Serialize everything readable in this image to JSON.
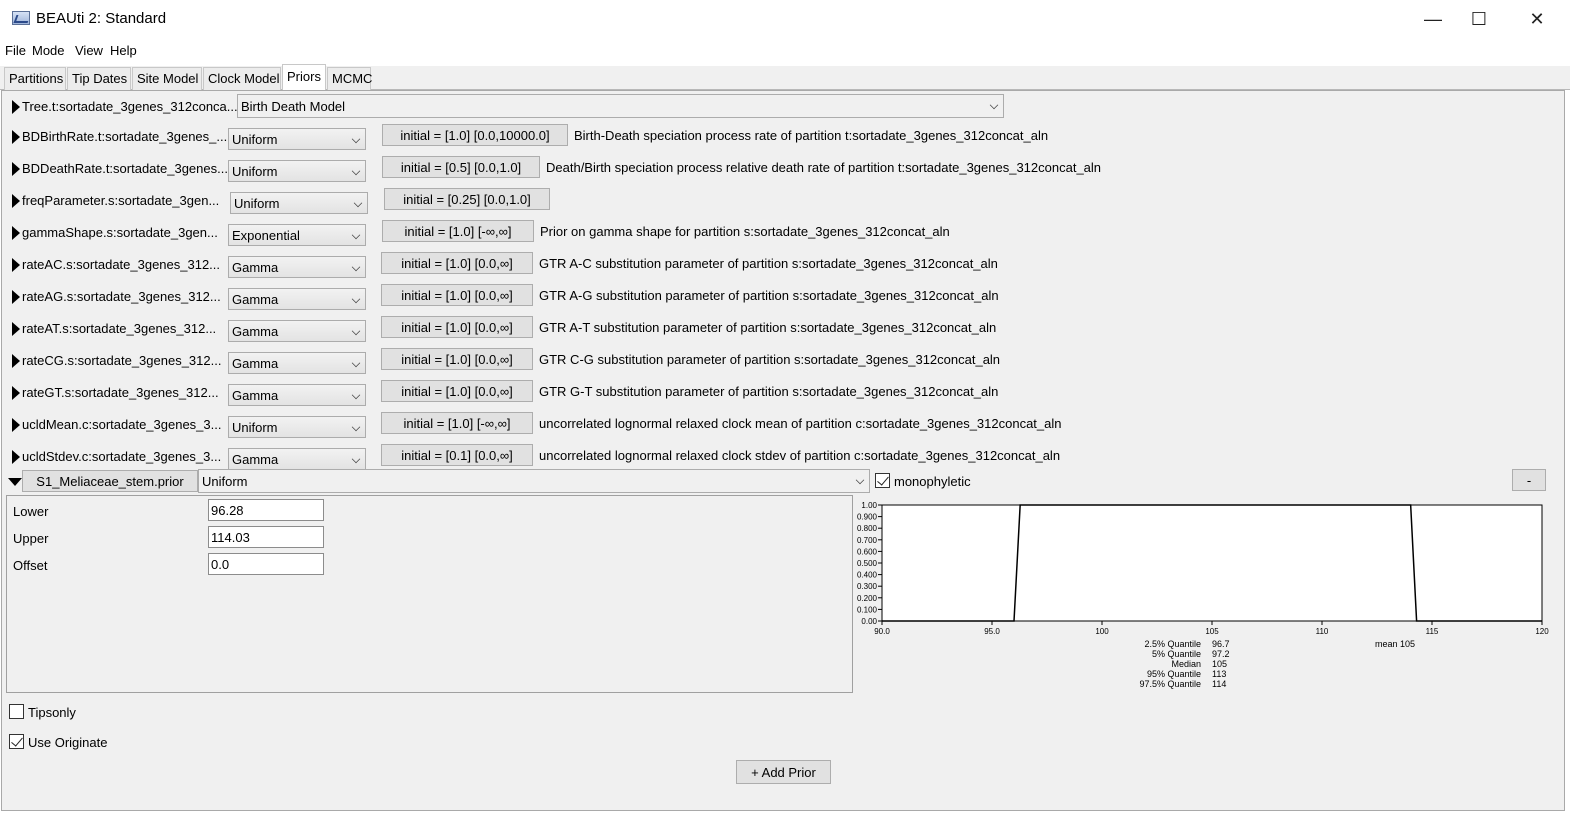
{
  "window": {
    "title": "BEAUti 2: Standard",
    "minimize_glyph": "—",
    "maximize_glyph": "☐",
    "close_glyph": "✕"
  },
  "menu": [
    "File",
    "Mode",
    "View",
    "Help"
  ],
  "tabs": [
    "Partitions",
    "Tip Dates",
    "Site Model",
    "Clock Model",
    "Priors",
    "MCMC"
  ],
  "active_tab": "Priors",
  "tree_prior": {
    "label": "Tree.t:sortadate_3genes_312conca...",
    "model": "Birth Death Model"
  },
  "priors": [
    {
      "label": "BDBirthRate.t:sortadate_3genes_...",
      "dist": "Uniform",
      "initial": "initial = [1.0] [0.0,10000.0]",
      "description": "Birth-Death speciation process rate of partition t:sortadate_3genes_312concat_aln"
    },
    {
      "label": "BDDeathRate.t:sortadate_3genes...",
      "dist": "Uniform",
      "initial": "initial = [0.5] [0.0,1.0]",
      "description": "Death/Birth speciation process relative death rate of partition t:sortadate_3genes_312concat_aln"
    },
    {
      "label": "freqParameter.s:sortadate_3gen...",
      "dist": "Uniform",
      "initial": "initial = [0.25] [0.0,1.0]",
      "description": ""
    },
    {
      "label": "gammaShape.s:sortadate_3gen...",
      "dist": "Exponential",
      "initial": "initial = [1.0] [-∞,∞]",
      "description": "Prior on gamma shape for partition s:sortadate_3genes_312concat_aln"
    },
    {
      "label": "rateAC.s:sortadate_3genes_312...",
      "dist": "Gamma",
      "initial": "initial = [1.0] [0.0,∞]",
      "description": "GTR A-C substitution parameter of partition s:sortadate_3genes_312concat_aln"
    },
    {
      "label": "rateAG.s:sortadate_3genes_312...",
      "dist": "Gamma",
      "initial": "initial = [1.0] [0.0,∞]",
      "description": "GTR A-G substitution parameter of partition s:sortadate_3genes_312concat_aln"
    },
    {
      "label": "rateAT.s:sortadate_3genes_312...",
      "dist": "Gamma",
      "initial": "initial = [1.0] [0.0,∞]",
      "description": "GTR A-T substitution parameter of partition s:sortadate_3genes_312concat_aln"
    },
    {
      "label": "rateCG.s:sortadate_3genes_312...",
      "dist": "Gamma",
      "initial": "initial = [1.0] [0.0,∞]",
      "description": "GTR C-G substitution parameter of partition s:sortadate_3genes_312concat_aln"
    },
    {
      "label": "rateGT.s:sortadate_3genes_312...",
      "dist": "Gamma",
      "initial": "initial = [1.0] [0.0,∞]",
      "description": "GTR G-T substitution parameter of partition s:sortadate_3genes_312concat_aln"
    },
    {
      "label": "ucldMean.c:sortadate_3genes_3...",
      "dist": "Uniform",
      "initial": "initial = [1.0] [-∞,∞]",
      "description": "uncorrelated lognormal relaxed clock mean of partition c:sortadate_3genes_312concat_aln"
    },
    {
      "label": "ucldStdev.c:sortadate_3genes_3...",
      "dist": "Gamma",
      "initial": "initial = [0.1] [0.0,∞]",
      "description": "uncorrelated lognormal relaxed clock stdev of partition c:sortadate_3genes_312concat_aln"
    }
  ],
  "mrca_prior": {
    "name": "S1_Meliaceae_stem.prior",
    "dist": "Uniform",
    "monophyletic_label": "monophyletic",
    "monophyletic": true,
    "remove_label": "-",
    "params": [
      {
        "label": "Lower",
        "value": "96.28"
      },
      {
        "label": "Upper",
        "value": "114.03"
      },
      {
        "label": "Offset",
        "value": "0.0"
      }
    ]
  },
  "chart_data": {
    "type": "line",
    "title": "",
    "xlabel": "",
    "ylabel": "",
    "xlim": [
      90,
      120
    ],
    "ylim": [
      0,
      1
    ],
    "x_ticks": [
      "90.0",
      "95.0",
      "100",
      "105",
      "110",
      "115",
      "120"
    ],
    "y_ticks": [
      "0.00",
      "0.100",
      "0.200",
      "0.300",
      "0.400",
      "0.500",
      "0.600",
      "0.700",
      "0.800",
      "0.900",
      "1.00"
    ],
    "series": [
      {
        "x": [
          90,
          96.0,
          96.28,
          114.03,
          114.3,
          120
        ],
        "y": [
          0,
          0,
          1,
          1,
          0,
          0
        ]
      }
    ],
    "mean_label": "mean 105",
    "quantiles": [
      {
        "name": "2.5% Quantile",
        "value": "96.7"
      },
      {
        "name": "5% Quantile",
        "value": "97.2"
      },
      {
        "name": "Median",
        "value": "105"
      },
      {
        "name": "95% Quantile",
        "value": "113"
      },
      {
        "name": "97.5% Quantile",
        "value": "114"
      }
    ]
  },
  "options": {
    "tipsonly_label": "Tipsonly",
    "tipsonly": false,
    "use_originate_label": "Use Originate",
    "use_originate": true
  },
  "add_prior_label": "+ Add Prior"
}
